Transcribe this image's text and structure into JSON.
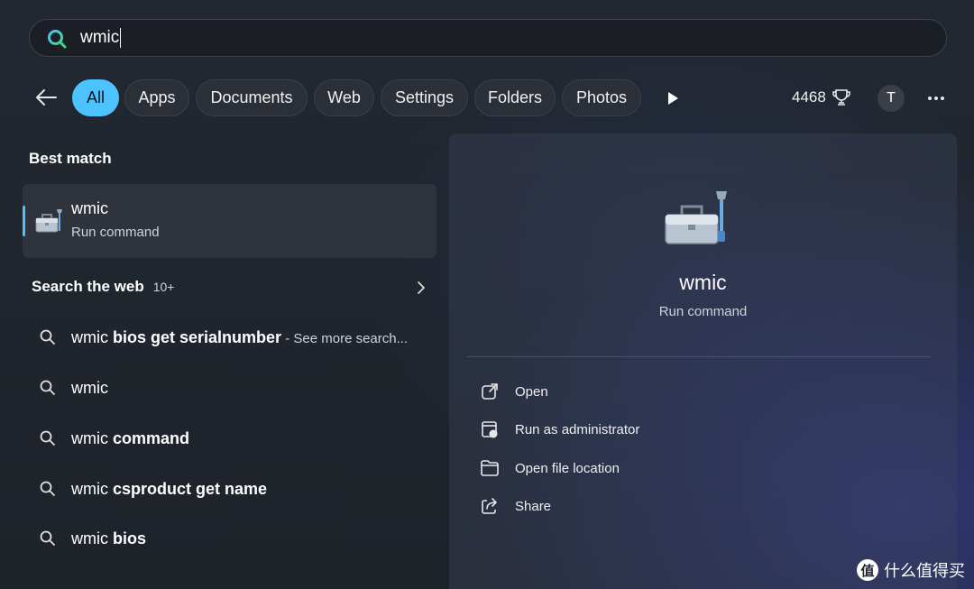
{
  "search": {
    "query": "wmic"
  },
  "filters": {
    "back_icon": "arrow-left-icon",
    "chips": [
      {
        "label": "All",
        "active": true
      },
      {
        "label": "Apps",
        "active": false
      },
      {
        "label": "Documents",
        "active": false
      },
      {
        "label": "Web",
        "active": false
      },
      {
        "label": "Settings",
        "active": false
      },
      {
        "label": "Folders",
        "active": false
      },
      {
        "label": "Photos",
        "active": false
      }
    ],
    "points": "4468",
    "points_icon": "trophy-icon",
    "avatar_initial": "T",
    "more_icon": "ellipsis-icon"
  },
  "best_match": {
    "heading": "Best match",
    "name": "wmic",
    "type": "Run command",
    "icon": "toolbox-icon"
  },
  "web": {
    "heading": "Search the web",
    "count": "10+",
    "suggestions": [
      {
        "prefix": "wmic",
        "bold": " bios get serialnumber",
        "more": " - See more search..."
      },
      {
        "prefix": "wmic",
        "bold": "",
        "more": ""
      },
      {
        "prefix": "wmic",
        "bold": " command",
        "more": ""
      },
      {
        "prefix": "wmic",
        "bold": " csproduct get name",
        "more": ""
      },
      {
        "prefix": "wmic",
        "bold": " bios",
        "more": ""
      }
    ]
  },
  "details": {
    "title": "wmic",
    "subtitle": "Run command",
    "actions": [
      {
        "label": "Open",
        "icon": "open-external-icon"
      },
      {
        "label": "Run as administrator",
        "icon": "shield-admin-icon"
      },
      {
        "label": "Open file location",
        "icon": "folder-icon"
      },
      {
        "label": "Share",
        "icon": "share-icon"
      }
    ]
  },
  "watermark": {
    "badge": "值",
    "text": "什么值得买"
  },
  "colors": {
    "accent": "#4cc2ff",
    "background": "#1f2329"
  }
}
